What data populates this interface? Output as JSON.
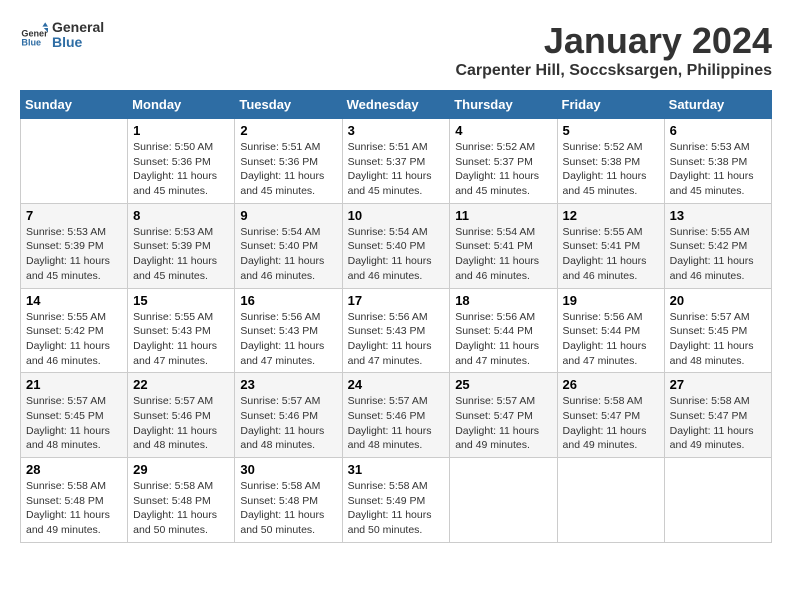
{
  "logo": {
    "text_general": "General",
    "text_blue": "Blue"
  },
  "title": "January 2024",
  "subtitle": "Carpenter Hill, Soccsksargen, Philippines",
  "days_of_week": [
    "Sunday",
    "Monday",
    "Tuesday",
    "Wednesday",
    "Thursday",
    "Friday",
    "Saturday"
  ],
  "weeks": [
    [
      {
        "day": "",
        "info": ""
      },
      {
        "day": "1",
        "info": "Sunrise: 5:50 AM\nSunset: 5:36 PM\nDaylight: 11 hours\nand 45 minutes."
      },
      {
        "day": "2",
        "info": "Sunrise: 5:51 AM\nSunset: 5:36 PM\nDaylight: 11 hours\nand 45 minutes."
      },
      {
        "day": "3",
        "info": "Sunrise: 5:51 AM\nSunset: 5:37 PM\nDaylight: 11 hours\nand 45 minutes."
      },
      {
        "day": "4",
        "info": "Sunrise: 5:52 AM\nSunset: 5:37 PM\nDaylight: 11 hours\nand 45 minutes."
      },
      {
        "day": "5",
        "info": "Sunrise: 5:52 AM\nSunset: 5:38 PM\nDaylight: 11 hours\nand 45 minutes."
      },
      {
        "day": "6",
        "info": "Sunrise: 5:53 AM\nSunset: 5:38 PM\nDaylight: 11 hours\nand 45 minutes."
      }
    ],
    [
      {
        "day": "7",
        "info": "Sunrise: 5:53 AM\nSunset: 5:39 PM\nDaylight: 11 hours\nand 45 minutes."
      },
      {
        "day": "8",
        "info": "Sunrise: 5:53 AM\nSunset: 5:39 PM\nDaylight: 11 hours\nand 45 minutes."
      },
      {
        "day": "9",
        "info": "Sunrise: 5:54 AM\nSunset: 5:40 PM\nDaylight: 11 hours\nand 46 minutes."
      },
      {
        "day": "10",
        "info": "Sunrise: 5:54 AM\nSunset: 5:40 PM\nDaylight: 11 hours\nand 46 minutes."
      },
      {
        "day": "11",
        "info": "Sunrise: 5:54 AM\nSunset: 5:41 PM\nDaylight: 11 hours\nand 46 minutes."
      },
      {
        "day": "12",
        "info": "Sunrise: 5:55 AM\nSunset: 5:41 PM\nDaylight: 11 hours\nand 46 minutes."
      },
      {
        "day": "13",
        "info": "Sunrise: 5:55 AM\nSunset: 5:42 PM\nDaylight: 11 hours\nand 46 minutes."
      }
    ],
    [
      {
        "day": "14",
        "info": "Sunrise: 5:55 AM\nSunset: 5:42 PM\nDaylight: 11 hours\nand 46 minutes."
      },
      {
        "day": "15",
        "info": "Sunrise: 5:55 AM\nSunset: 5:43 PM\nDaylight: 11 hours\nand 47 minutes."
      },
      {
        "day": "16",
        "info": "Sunrise: 5:56 AM\nSunset: 5:43 PM\nDaylight: 11 hours\nand 47 minutes."
      },
      {
        "day": "17",
        "info": "Sunrise: 5:56 AM\nSunset: 5:43 PM\nDaylight: 11 hours\nand 47 minutes."
      },
      {
        "day": "18",
        "info": "Sunrise: 5:56 AM\nSunset: 5:44 PM\nDaylight: 11 hours\nand 47 minutes."
      },
      {
        "day": "19",
        "info": "Sunrise: 5:56 AM\nSunset: 5:44 PM\nDaylight: 11 hours\nand 47 minutes."
      },
      {
        "day": "20",
        "info": "Sunrise: 5:57 AM\nSunset: 5:45 PM\nDaylight: 11 hours\nand 48 minutes."
      }
    ],
    [
      {
        "day": "21",
        "info": "Sunrise: 5:57 AM\nSunset: 5:45 PM\nDaylight: 11 hours\nand 48 minutes."
      },
      {
        "day": "22",
        "info": "Sunrise: 5:57 AM\nSunset: 5:46 PM\nDaylight: 11 hours\nand 48 minutes."
      },
      {
        "day": "23",
        "info": "Sunrise: 5:57 AM\nSunset: 5:46 PM\nDaylight: 11 hours\nand 48 minutes."
      },
      {
        "day": "24",
        "info": "Sunrise: 5:57 AM\nSunset: 5:46 PM\nDaylight: 11 hours\nand 48 minutes."
      },
      {
        "day": "25",
        "info": "Sunrise: 5:57 AM\nSunset: 5:47 PM\nDaylight: 11 hours\nand 49 minutes."
      },
      {
        "day": "26",
        "info": "Sunrise: 5:58 AM\nSunset: 5:47 PM\nDaylight: 11 hours\nand 49 minutes."
      },
      {
        "day": "27",
        "info": "Sunrise: 5:58 AM\nSunset: 5:47 PM\nDaylight: 11 hours\nand 49 minutes."
      }
    ],
    [
      {
        "day": "28",
        "info": "Sunrise: 5:58 AM\nSunset: 5:48 PM\nDaylight: 11 hours\nand 49 minutes."
      },
      {
        "day": "29",
        "info": "Sunrise: 5:58 AM\nSunset: 5:48 PM\nDaylight: 11 hours\nand 50 minutes."
      },
      {
        "day": "30",
        "info": "Sunrise: 5:58 AM\nSunset: 5:48 PM\nDaylight: 11 hours\nand 50 minutes."
      },
      {
        "day": "31",
        "info": "Sunrise: 5:58 AM\nSunset: 5:49 PM\nDaylight: 11 hours\nand 50 minutes."
      },
      {
        "day": "",
        "info": ""
      },
      {
        "day": "",
        "info": ""
      },
      {
        "day": "",
        "info": ""
      }
    ]
  ]
}
